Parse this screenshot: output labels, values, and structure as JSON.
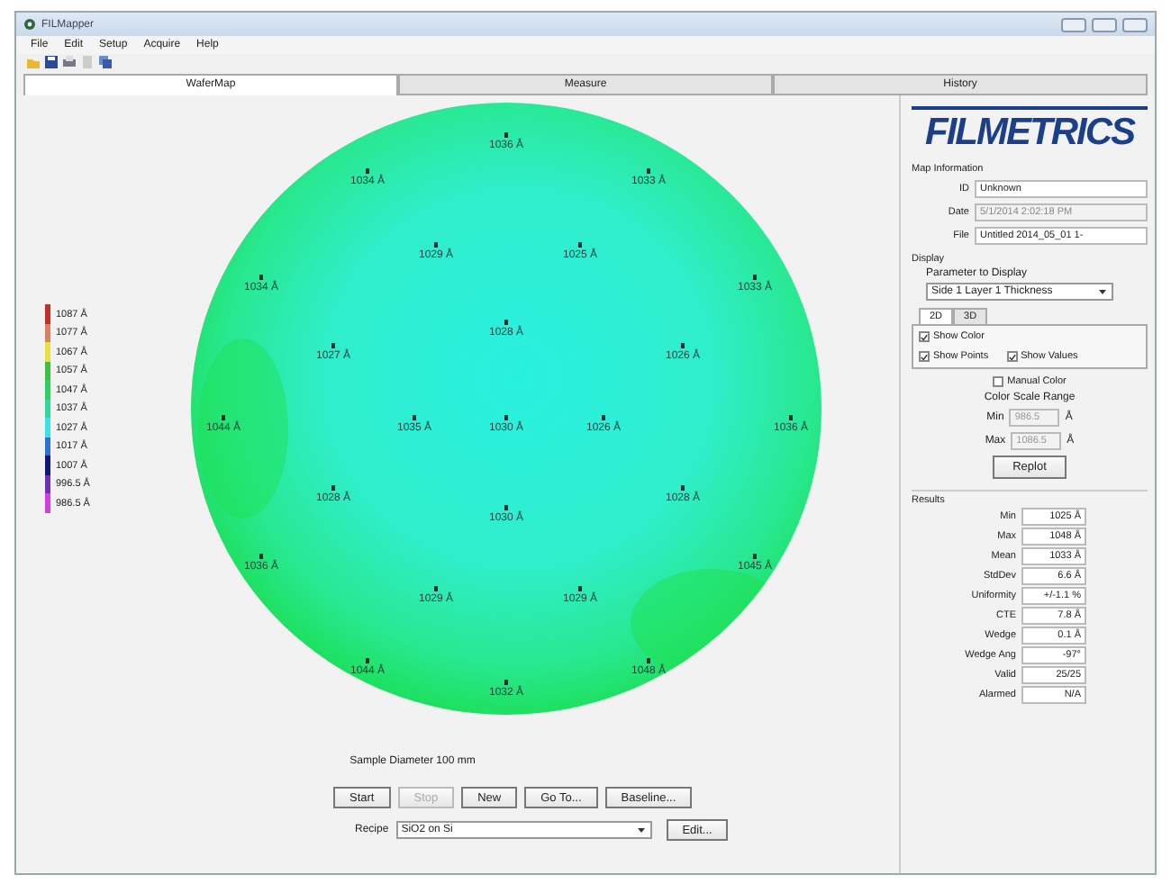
{
  "window": {
    "title": "FILMapper"
  },
  "menu": [
    "File",
    "Edit",
    "Setup",
    "Acquire",
    "Help"
  ],
  "tabs": [
    {
      "label": "WaferMap",
      "selected": true
    },
    {
      "label": "Measure",
      "selected": false
    },
    {
      "label": "History",
      "selected": false
    }
  ],
  "legend": [
    {
      "label": "1087 Å",
      "color": "#c0302a"
    },
    {
      "label": "1077 Å",
      "color": "#d98060"
    },
    {
      "label": "1067 Å",
      "color": "#e8e040"
    },
    {
      "label": "1057 Å",
      "color": "#40c040"
    },
    {
      "label": "1047 Å",
      "color": "#30d060"
    },
    {
      "label": "1037 Å",
      "color": "#30d8a0"
    },
    {
      "label": "1027 Å",
      "color": "#40e0e8"
    },
    {
      "label": "1017 Å",
      "color": "#3070d0"
    },
    {
      "label": "1007 Å",
      "color": "#101870"
    },
    {
      "label": "996.5 Å",
      "color": "#7030b0"
    },
    {
      "label": "986.5 Å",
      "color": "#d040e0"
    }
  ],
  "wafer_map": {
    "points": [
      "1036 Å",
      "1034 Å",
      "1033 Å",
      "1029 Å",
      "1025 Å",
      "1034 Å",
      "1033 Å",
      "1028 Å",
      "1027 Å",
      "1026 Å",
      "1044 Å",
      "1035 Å",
      "1030 Å",
      "1026 Å",
      "1036 Å",
      "1028 Å",
      "1028 Å",
      "1030 Å",
      "1036 Å",
      "1045 Å",
      "1029 Å",
      "1029 Å",
      "1044 Å",
      "1048 Å",
      "1032 Å"
    ],
    "caption": "Sample Diameter 100 mm"
  },
  "buttons": [
    {
      "label": "Start",
      "disabled": false
    },
    {
      "label": "Stop",
      "disabled": true
    },
    {
      "label": "New",
      "disabled": false
    },
    {
      "label": "Go To...",
      "disabled": false
    },
    {
      "label": "Baseline...",
      "disabled": false
    }
  ],
  "recipe": {
    "label": "Recipe",
    "value": "SiO2 on Si",
    "edit": "Edit..."
  },
  "logo": "FILMETRICS",
  "map_information": {
    "title": "Map Information",
    "fields": [
      {
        "label": "ID",
        "value": "Unknown",
        "disabled": false
      },
      {
        "label": "Date",
        "value": "5/1/2014 2:02:18 PM",
        "disabled": true
      },
      {
        "label": "File",
        "value": "Untitled 2014_05_01 1-",
        "disabled": false
      }
    ]
  },
  "display": {
    "title": "Display",
    "parameter_label": "Parameter to Display",
    "parameter": "Side 1 Layer 1 Thickness",
    "view_tabs": [
      {
        "label": "2D",
        "selected": true
      },
      {
        "label": "3D",
        "selected": false
      }
    ],
    "options": [
      {
        "label": "Show Color",
        "checked": true
      },
      {
        "label": "Show Points",
        "checked": true
      },
      {
        "label": "Show Values",
        "checked": true
      }
    ],
    "manual_color": {
      "label": "Manual Color",
      "checked": false
    },
    "range_title": "Color Scale Range",
    "range": [
      {
        "label": "Min",
        "value": "986.5",
        "unit": "Å"
      },
      {
        "label": "Max",
        "value": "1086.5",
        "unit": "Å"
      }
    ],
    "replot": "Replot"
  },
  "results": {
    "title": "Results",
    "rows": [
      {
        "label": "Min",
        "value": "1025 Å"
      },
      {
        "label": "Max",
        "value": "1048 Å"
      },
      {
        "label": "Mean",
        "value": "1033 Å"
      },
      {
        "label": "StdDev",
        "value": "6.6 Å"
      },
      {
        "label": "Uniformity",
        "value": "+/-1.1 %"
      },
      {
        "label": "CTE",
        "value": "7.8 Å"
      },
      {
        "label": "Wedge",
        "value": "0.1 Å"
      },
      {
        "label": "Wedge Ang",
        "value": "-97°"
      },
      {
        "label": "Valid",
        "value": "25/25"
      },
      {
        "label": "Alarmed",
        "value": "N/A"
      }
    ]
  }
}
